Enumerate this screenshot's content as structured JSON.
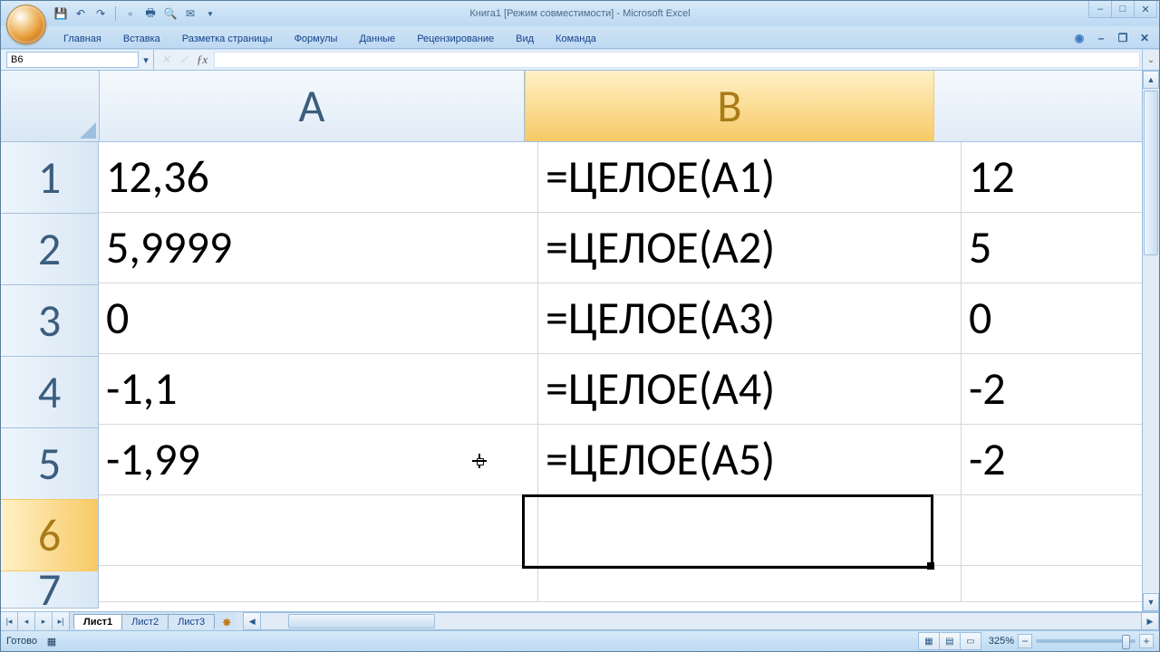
{
  "window": {
    "title": "Книга1  [Режим совместимости] - Microsoft Excel"
  },
  "ribbon": {
    "tabs": [
      "Главная",
      "Вставка",
      "Разметка страницы",
      "Формулы",
      "Данные",
      "Рецензирование",
      "Вид",
      "Команда"
    ],
    "active_index": -1
  },
  "name_box": "B6",
  "formula_bar_value": "",
  "columns": {
    "A": "A",
    "B": "B"
  },
  "rows": [
    "1",
    "2",
    "3",
    "4",
    "5",
    "6",
    "7"
  ],
  "selected_row_index": 5,
  "cells": [
    {
      "A": "12,36",
      "B": "=ЦЕЛОЕ(A1)",
      "C": "12"
    },
    {
      "A": "5,9999",
      "B": "=ЦЕЛОЕ(A2)",
      "C": "5"
    },
    {
      "A": "0",
      "B": "=ЦЕЛОЕ(A3)",
      "C": "0"
    },
    {
      "A": "-1,1",
      "B": "=ЦЕЛОЕ(A4)",
      "C": "-2"
    },
    {
      "A": "-1,99",
      "B": "=ЦЕЛОЕ(A5)",
      "C": "-2"
    },
    {
      "A": "",
      "B": "",
      "C": ""
    },
    {
      "A": "",
      "B": "",
      "C": ""
    }
  ],
  "selected_cell": "B6",
  "sheets": {
    "list": [
      "Лист1",
      "Лист2",
      "Лист3"
    ],
    "active": 0
  },
  "status": {
    "ready": "Готово",
    "zoom": "325%"
  }
}
